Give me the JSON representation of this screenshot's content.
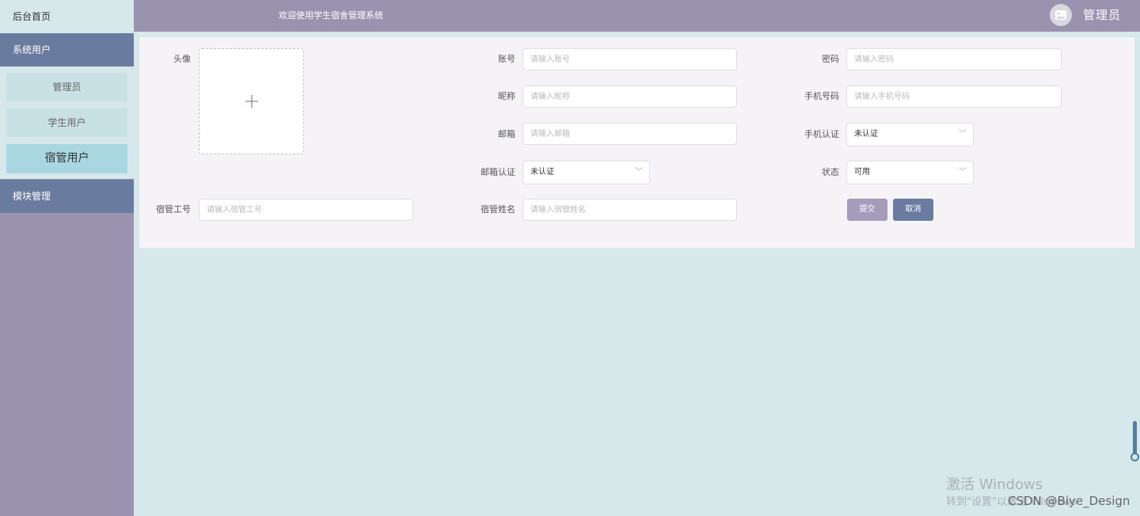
{
  "sidebar": {
    "home": "后台首页",
    "group_system": "系统用户",
    "items": [
      {
        "label": "管理员"
      },
      {
        "label": "学生用户"
      },
      {
        "label": "宿管用户"
      }
    ],
    "group_module": "模块管理"
  },
  "topbar": {
    "welcome": "欢迎使用学生宿舍管理系统",
    "user": "管理员"
  },
  "form": {
    "avatar_label": "头像",
    "account_label": "账号",
    "account_placeholder": "请输入账号",
    "password_label": "密码",
    "password_placeholder": "请输入密码",
    "nickname_label": "昵称",
    "nickname_placeholder": "请输入昵称",
    "phone_label": "手机号码",
    "phone_placeholder": "请输入手机号码",
    "email_label": "邮箱",
    "email_placeholder": "请输入邮箱",
    "phone_verify_label": "手机认证",
    "phone_verify_value": "未认证",
    "email_verify_label": "邮箱认证",
    "email_verify_value": "未认证",
    "status_label": "状态",
    "status_value": "可用",
    "staff_no_label": "宿管工号",
    "staff_no_placeholder": "请输入宿管工号",
    "staff_name_label": "宿管姓名",
    "staff_name_placeholder": "请输入宿管姓名",
    "submit": "提交",
    "cancel": "取消"
  },
  "overlay": {
    "activate_title": "激活 Windows",
    "activate_sub": "转到\"设置\"以激活 Windows",
    "csdn": "CSDN @Biye_Design"
  },
  "colors": {
    "sidebar_bg": "#9a93b0",
    "group_bg": "#6a7ba0",
    "page_bg": "#d6e8ea",
    "submit_bg": "#a49cba",
    "cancel_bg": "#6a7ba0"
  }
}
